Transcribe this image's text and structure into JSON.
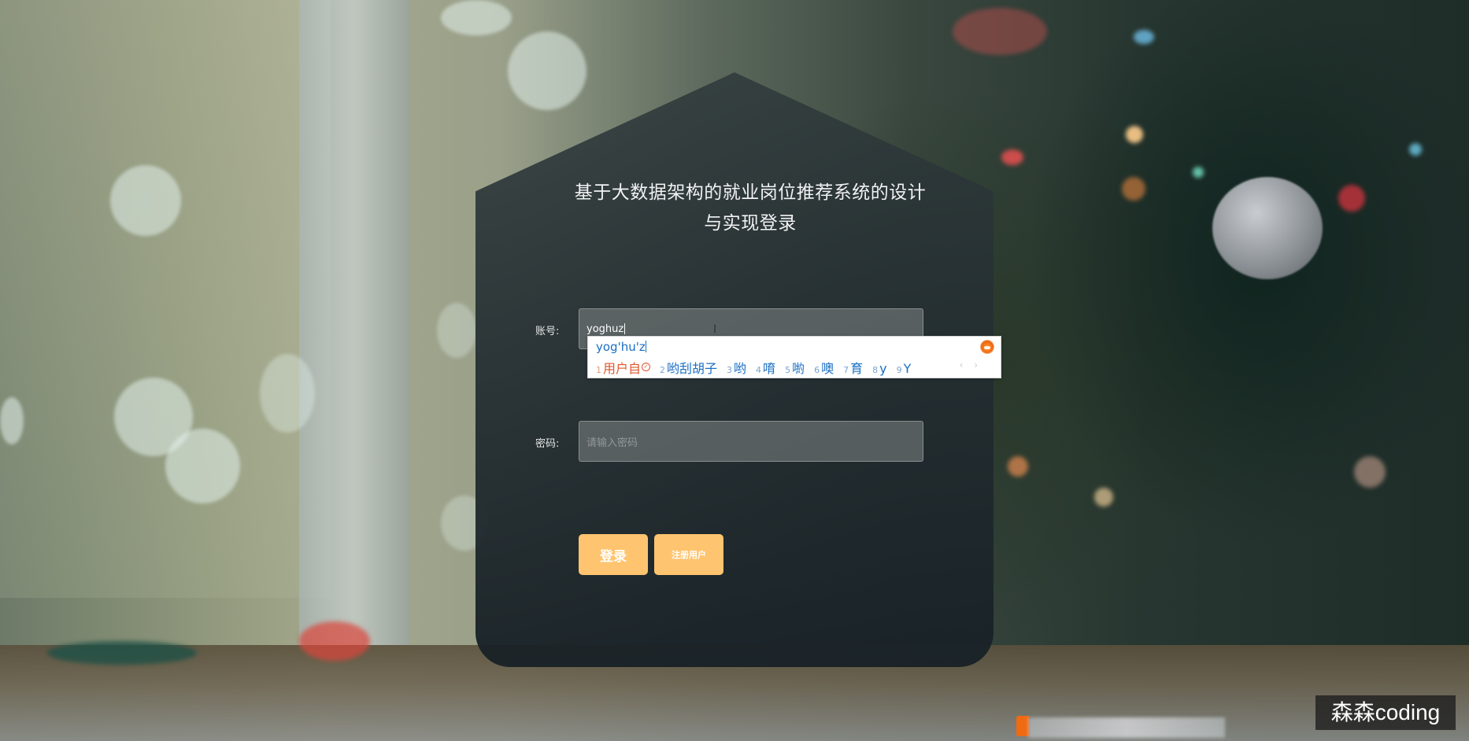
{
  "login": {
    "title": "基于大数据架构的就业岗位推荐系统的设计与实现登录",
    "account_label": "账号:",
    "account_value": "yoghuz",
    "password_label": "密码:",
    "password_placeholder": "请输入密码",
    "login_button": "登录",
    "register_button": "注册用户",
    "accent_color": "#ffc46f"
  },
  "ime": {
    "composition": "yog'hu'z",
    "candidates": [
      {
        "num": "1",
        "text": "用户自"
      },
      {
        "num": "2",
        "text": "哟刮胡子"
      },
      {
        "num": "3",
        "text": "哟"
      },
      {
        "num": "4",
        "text": "唷"
      },
      {
        "num": "5",
        "text": "喲"
      },
      {
        "num": "6",
        "text": "噢"
      },
      {
        "num": "7",
        "text": "育"
      },
      {
        "num": "8",
        "text": "y"
      },
      {
        "num": "9",
        "text": "Y"
      }
    ],
    "pager": "‹ ›"
  },
  "watermark": "森森coding"
}
